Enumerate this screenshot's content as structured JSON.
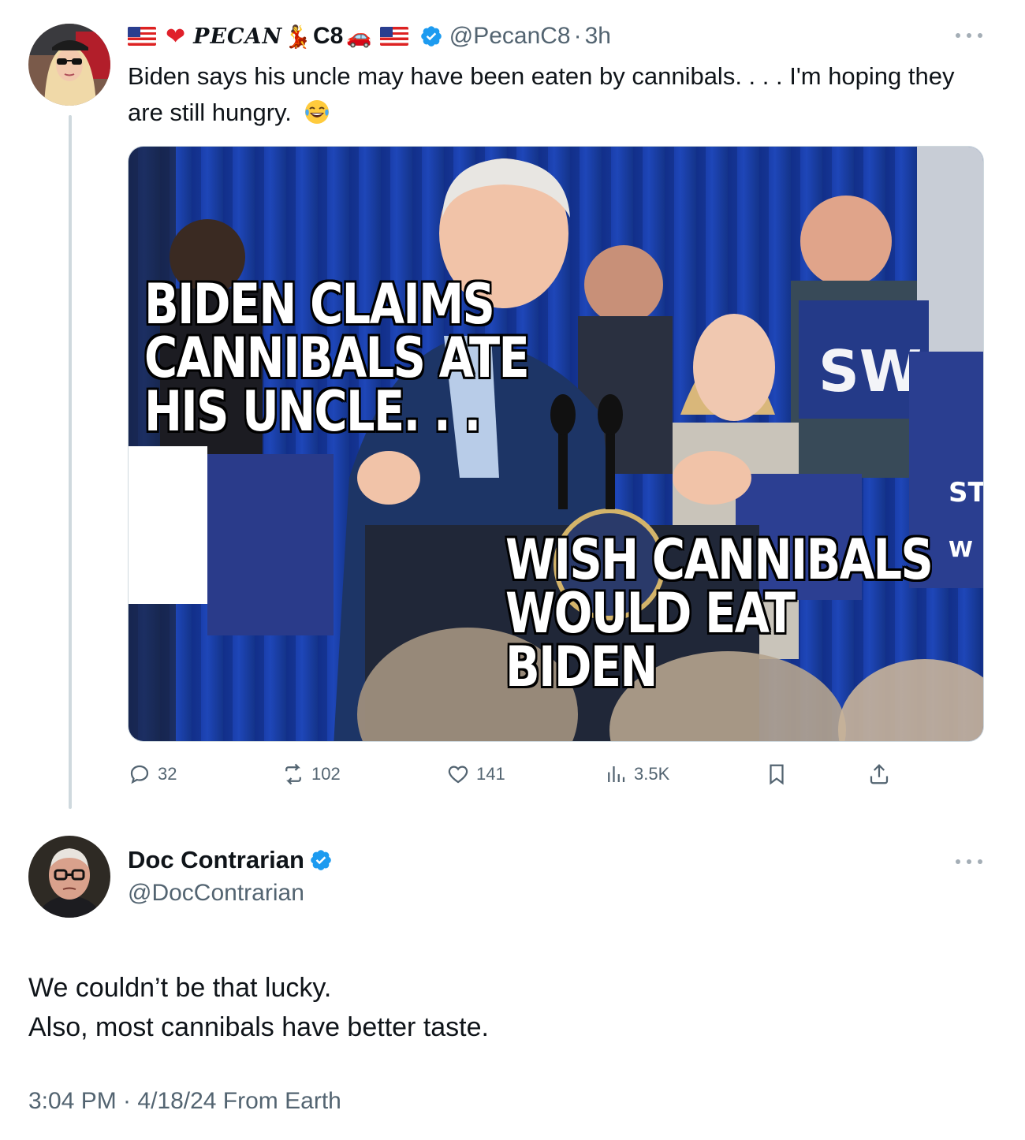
{
  "tweet1": {
    "display_name_prefix": "PECAN",
    "display_name_suffix": "C8",
    "handle": "@PecanC8",
    "separator": "·",
    "time": "3h",
    "text": "Biden says his uncle may have been eaten by cannibals. . . . I'm hoping they are still hungry.",
    "emoji": "face-with-tears-of-joy",
    "image": {
      "caption_top": "Biden claims cannibals ate his uncle. . .",
      "caption_bottom": "Wish cannibals would eat Biden"
    },
    "actions": {
      "replies": "32",
      "reposts": "102",
      "likes": "141",
      "views": "3.5K"
    }
  },
  "tweet2": {
    "display_name": "Doc Contrarian",
    "handle": "@DocContrarian",
    "text_line1": "We couldn’t be that lucky.",
    "text_line2": "Also, most cannibals have better taste.",
    "timestamp": "3:04 PM · 4/18/24 From Earth"
  },
  "colors": {
    "verified": "#1d9bf0",
    "secondary_text": "#536471",
    "thread_line": "#cfd9de"
  },
  "icons": [
    "reply-icon",
    "repost-icon",
    "like-icon",
    "views-icon",
    "bookmark-icon",
    "share-icon",
    "more-icon",
    "verified-badge-icon"
  ]
}
